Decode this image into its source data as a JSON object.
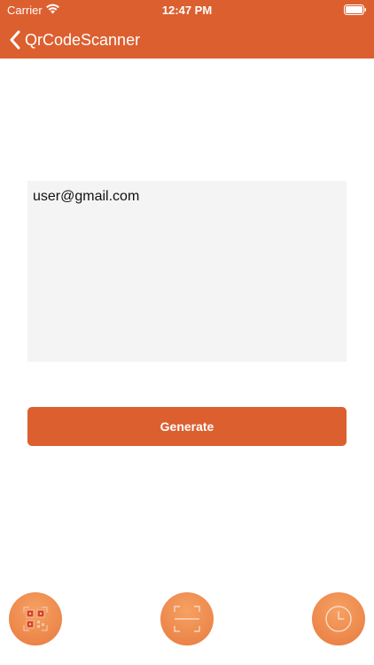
{
  "status_bar": {
    "carrier": "Carrier",
    "time": "12:47 PM"
  },
  "nav": {
    "title": "QrCodeScanner"
  },
  "input": {
    "value": "user@gmail.com"
  },
  "generate_button": {
    "label": "Generate"
  },
  "tabs": [
    {
      "icon": "qr-code-icon"
    },
    {
      "icon": "scan-frame-icon"
    },
    {
      "icon": "clock-icon"
    }
  ],
  "colors": {
    "accent": "#DC5F2F",
    "tab_gradient_light": "#F5A162",
    "tab_gradient_dark": "#E67A40",
    "input_background": "#F4F4F4"
  }
}
